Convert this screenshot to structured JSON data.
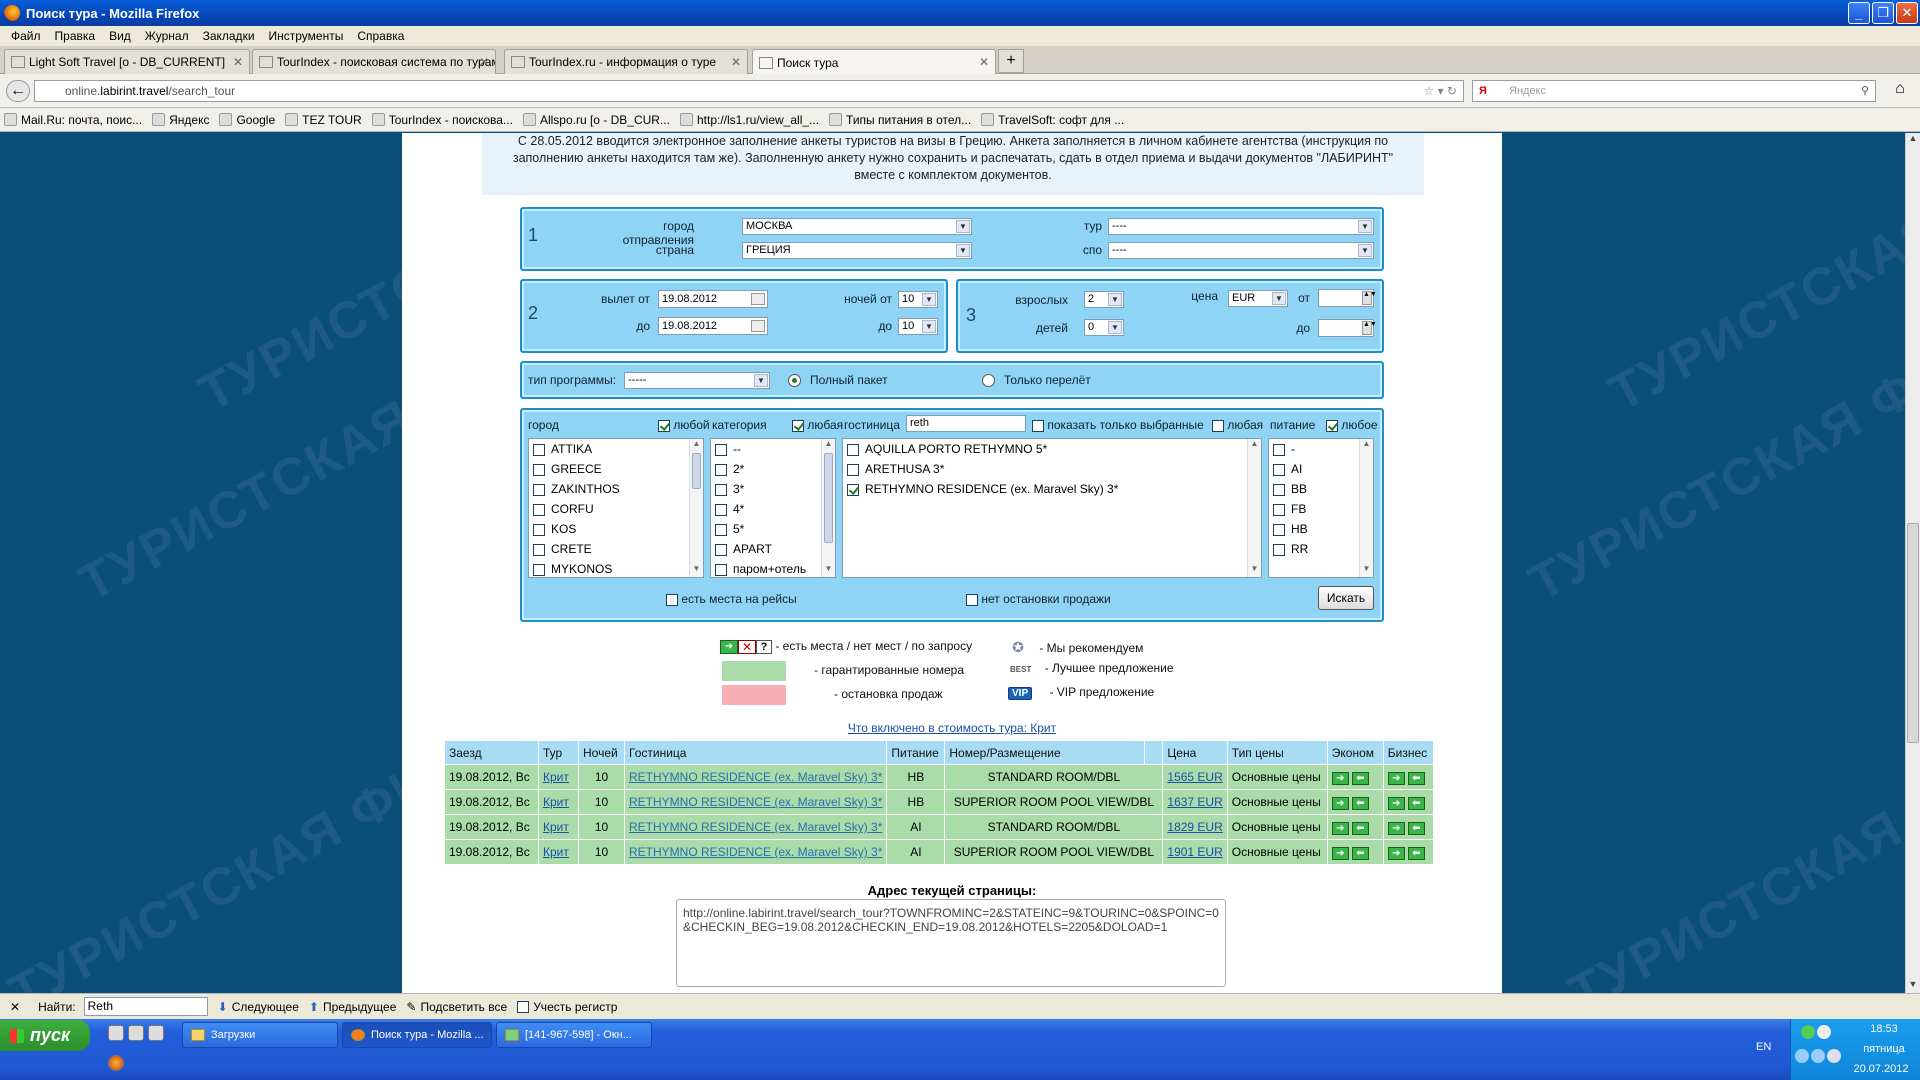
{
  "window": {
    "title": "Поиск тура - Mozilla Firefox"
  },
  "menu": [
    "Файл",
    "Правка",
    "Вид",
    "Журнал",
    "Закладки",
    "Инструменты",
    "Справка"
  ],
  "tabs": [
    {
      "label": "Light Soft Travel [о - DB_CURRENT]"
    },
    {
      "label": "TourIndex - поисковая система по турам"
    },
    {
      "label": "TourIndex.ru - информация о туре"
    },
    {
      "label": "Поиск тура"
    }
  ],
  "nav": {
    "url_prefix": "online.",
    "url_host": "labirint.travel",
    "url_path": "/search_tour",
    "search_engine": "Я",
    "search_placeholder": "Яндекс"
  },
  "bookmarks": [
    "Mail.Ru: почта, поис...",
    "Яндекс",
    "Google",
    "TEZ TOUR",
    "TourIndex - поискова...",
    "Allspo.ru [о - DB_CUR...",
    "http://ls1.ru/view_all_...",
    "Типы питания в отел...",
    "TravelSoft: софт для ..."
  ],
  "watermark": "ТУРИСТСКАЯ ФИРМА ЛАБИРИНТ",
  "notice": "С 28.05.2012 вводится электронное заполнение анкеты туристов на визы в Грецию. Анкета заполняется в личном кабинете агентства (инструкция по заполнению анкеты находится там же). Заполненную анкету нужно сохранить и распечатать, сдать в отдел приема и выдачи документов \"ЛАБИРИНТ\" вместе с комплектом документов.",
  "form1": {
    "num": "1",
    "city_label": "город отправления",
    "city_value": "МОСКВА",
    "country_label": "страна",
    "country_value": "ГРЕЦИЯ",
    "tour_label": "тур",
    "tour_value": "----",
    "spo_label": "спо",
    "spo_value": "----"
  },
  "form2": {
    "num": "2",
    "from_label": "вылет от",
    "from_value": "19.08.2012",
    "to_label": "до",
    "to_value": "19.08.2012",
    "nights_from_label": "ночей от",
    "nights_from": "10",
    "nights_to_label": "до",
    "nights_to": "10"
  },
  "form3": {
    "num": "3",
    "adults_label": "взрослых",
    "adults": "2",
    "children_label": "детей",
    "children": "0",
    "price_label": "цена",
    "currency": "EUR",
    "price_from_label": "от",
    "price_to_label": "до"
  },
  "program": {
    "label": "тип программы:",
    "value": "-----",
    "opt_full": "Полный пакет",
    "opt_flight": "Только перелёт"
  },
  "filters": {
    "city_header": "город",
    "city_any": "любой",
    "category_header": "категория",
    "category_any": "любая",
    "hotel_header": "гостиница",
    "hotel_search": "reth",
    "show_selected": "показать только выбранные",
    "hotel_any": "любая",
    "meal_header": "питание",
    "meal_any": "любое",
    "cities": [
      "ATTIKA",
      "GREECE",
      "ZAKINTHOS",
      "CORFU",
      "KOS",
      "CRETE",
      "MYKONOS"
    ],
    "categories": [
      "--",
      "2*",
      "3*",
      "4*",
      "5*",
      "APART",
      "паром+отель"
    ],
    "hotels": [
      {
        "name": "AQUILLA PORTO RETHYMNO 5*",
        "checked": false
      },
      {
        "name": "ARETHUSA 3*",
        "checked": false
      },
      {
        "name": "RETHYMNO RESIDENCE (ex. Maravel Sky) 3*",
        "checked": true
      }
    ],
    "meals": [
      "-",
      "AI",
      "BB",
      "FB",
      "HB",
      "RR"
    ],
    "seats_label": "есть места на рейсы",
    "no_stop_label": "нет остановки продажи",
    "search_button": "Искать"
  },
  "legend": {
    "availability": "- есть места / нет мест / по запросу",
    "recommend": "- Мы рекомендуем",
    "guaranteed": "- гарантированные номера",
    "best": "- Лучшее предложение",
    "stop": "- остановка продаж",
    "vip_badge": "VIP",
    "vip": "- VIP предложение",
    "best_badge": "BEST",
    "colors": {
      "guaranteed": "#a9dca9",
      "stop": "#f7aeb4"
    }
  },
  "included_link": "Что включено в стоимость тура: Крит",
  "table": {
    "headers": [
      "Заезд",
      "Тур",
      "Ночей",
      "Гостиница",
      "Питание",
      "Номер/Размещение",
      "",
      "Цена",
      "Тип цены",
      "Эконом",
      "Бизнес"
    ],
    "rows": [
      {
        "date": "19.08.2012, Вс",
        "tour": "Крит",
        "nights": "10",
        "hotel": "RETHYMNO RESIDENCE (ex. Maravel Sky) 3*",
        "meal": "HB",
        "room": "STANDARD ROOM/DBL",
        "price": "1565 EUR",
        "price_type": "Основные цены"
      },
      {
        "date": "19.08.2012, Вс",
        "tour": "Крит",
        "nights": "10",
        "hotel": "RETHYMNO RESIDENCE (ex. Maravel Sky) 3*",
        "meal": "HB",
        "room": "SUPERIOR ROOM POOL VIEW/DBL",
        "price": "1637 EUR",
        "price_type": "Основные цены"
      },
      {
        "date": "19.08.2012, Вс",
        "tour": "Крит",
        "nights": "10",
        "hotel": "RETHYMNO RESIDENCE (ex. Maravel Sky) 3*",
        "meal": "AI",
        "room": "STANDARD ROOM/DBL",
        "price": "1829 EUR",
        "price_type": "Основные цены"
      },
      {
        "date": "19.08.2012, Вс",
        "tour": "Крит",
        "nights": "10",
        "hotel": "RETHYMNO RESIDENCE (ex. Maravel Sky) 3*",
        "meal": "AI",
        "room": "SUPERIOR ROOM POOL VIEW/DBL",
        "price": "1901 EUR",
        "price_type": "Основные цены"
      }
    ]
  },
  "address": {
    "label": "Адрес текущей страницы:",
    "value": "http://online.labirint.travel/search_tour?TOWNFROMINC=2&STATEINC=9&TOURINC=0&SPOINC=0&CHECKIN_BEG=19.08.2012&CHECKIN_END=19.08.2012&HOTELS=2205&DOLOAD=1"
  },
  "findbar": {
    "label": "Найти:",
    "value": "Reth",
    "next": "Следующее",
    "prev": "Предыдущее",
    "highlight": "Подсветить все",
    "case": "Учесть регистр"
  },
  "taskbar": {
    "start": "пуск",
    "items": [
      "Загрузки",
      "Поиск тура - Mozilla ...",
      "[141-967-598] - Окн..."
    ],
    "lang": "EN",
    "time": "18:53",
    "day": "пятница",
    "date": "20.07.2012"
  }
}
